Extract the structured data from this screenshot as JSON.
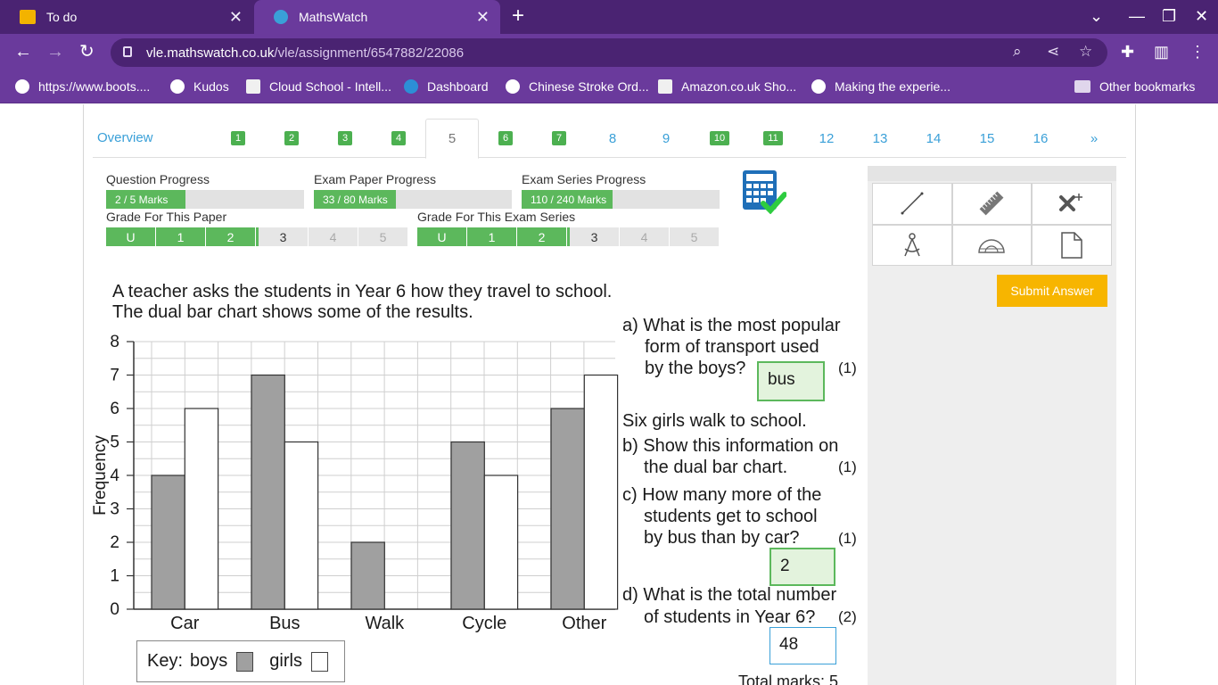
{
  "browser": {
    "tabs": [
      {
        "title": "To do",
        "fav_color": "#f3b300"
      },
      {
        "title": "MathsWatch",
        "fav_color": "#3aa0d8"
      }
    ],
    "url_host": "vle.mathswatch.co.uk",
    "url_path": "/vle/assignment/6547882/22086",
    "bookmarks": [
      {
        "label": "https://www.boots...."
      },
      {
        "label": "Kudos"
      },
      {
        "label": "Cloud School - Intell..."
      },
      {
        "label": "Dashboard"
      },
      {
        "label": "Chinese Stroke Ord..."
      },
      {
        "label": "Amazon.co.uk Sho..."
      },
      {
        "label": "Making the experie..."
      },
      {
        "label": "Other bookmarks"
      }
    ]
  },
  "nav": {
    "overview": "Overview",
    "questions": [
      {
        "label": "1",
        "done": true
      },
      {
        "label": "2",
        "done": true
      },
      {
        "label": "3",
        "done": true
      },
      {
        "label": "4",
        "done": true
      },
      {
        "label": "5",
        "done": false,
        "active": true
      },
      {
        "label": "6",
        "done": true
      },
      {
        "label": "7",
        "done": true
      },
      {
        "label": "8",
        "done": false
      },
      {
        "label": "9",
        "done": false
      },
      {
        "label": "10",
        "done": true
      },
      {
        "label": "11",
        "done": true
      },
      {
        "label": "12",
        "done": false
      },
      {
        "label": "13",
        "done": false
      },
      {
        "label": "14",
        "done": false
      },
      {
        "label": "15",
        "done": false
      },
      {
        "label": "16",
        "done": false
      }
    ],
    "more": "»"
  },
  "progress": {
    "question": {
      "label": "Question Progress",
      "text": "2 / 5 Marks",
      "fraction": 0.4
    },
    "paper": {
      "label": "Exam Paper Progress",
      "text": "33 / 80 Marks",
      "fraction": 0.4125
    },
    "series": {
      "label": "Exam Series Progress",
      "text": "110 / 240 Marks",
      "fraction": 0.458
    }
  },
  "grades": {
    "paper_label": "Grade For This Paper",
    "series_label": "Grade For This Exam Series",
    "levels": [
      "U",
      "1",
      "2",
      "3",
      "4",
      "5"
    ],
    "current_index": 3
  },
  "question": {
    "intro_1": "A teacher asks the students in Year 6 how they travel to school.",
    "intro_2": "The dual bar chart shows some of the results.",
    "a_1": "a) What is the most popular",
    "a_2": "form of transport used",
    "a_3": "by the boys?",
    "a_answer": "bus",
    "a_marks": "(1)",
    "girls_walk": "Six girls walk to school.",
    "b_1": "b) Show this information on",
    "b_2": "the dual bar chart.",
    "b_marks": "(1)",
    "c_1": "c) How many more of the",
    "c_2": "students get to school",
    "c_3": "by bus than by car?",
    "c_marks": "(1)",
    "c_answer": "2",
    "d_1": "d) What is the total number",
    "d_2": "of students in Year 6?",
    "d_marks": "(2)",
    "d_answer": "48",
    "total": "Total marks: 5"
  },
  "key": {
    "label": "Key:",
    "boys": "boys",
    "girls": "girls"
  },
  "chart_data": {
    "type": "bar",
    "categories": [
      "Car",
      "Bus",
      "Walk",
      "Cycle",
      "Other"
    ],
    "series": [
      {
        "name": "boys",
        "values": [
          4,
          7,
          2,
          5,
          6
        ],
        "color": "#a0a0a0"
      },
      {
        "name": "girls",
        "values": [
          6,
          5,
          0,
          4,
          7
        ],
        "color": "#ffffff"
      }
    ],
    "ylabel": "Frequency",
    "ylim": [
      0,
      8
    ],
    "yticks": [
      "0",
      "1",
      "2",
      "3",
      "4",
      "5",
      "6",
      "7",
      "8"
    ],
    "grid": true
  },
  "tools": [
    "line-tool-icon",
    "ruler-icon",
    "point-icon",
    "compass-icon",
    "protractor-icon",
    "page-icon"
  ],
  "submit_label": "Submit Answer",
  "colors": {
    "accent": "#3aa0d8",
    "done": "#5cb85c",
    "submit": "#f7b500",
    "chrome": "#6a3a9c"
  }
}
